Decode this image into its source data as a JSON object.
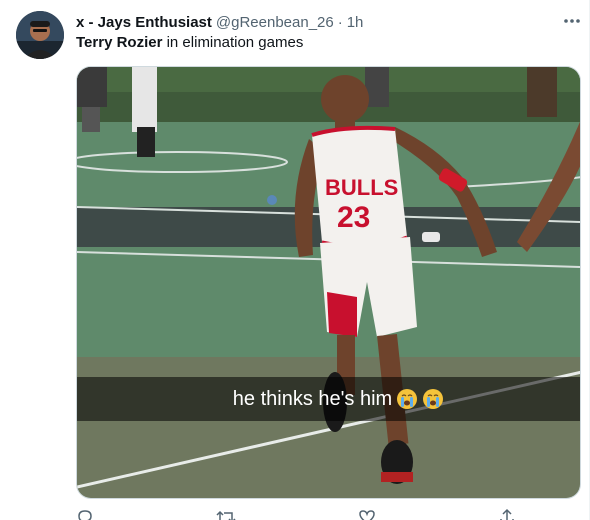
{
  "author": {
    "display_name": "x - Jays Enthusiast",
    "handle": "@gReenbean_26",
    "separator": "·",
    "time": "1h"
  },
  "tweet": {
    "mention": "Terry Rozier",
    "text_rest": " in elimination games"
  },
  "media": {
    "caption": "he thinks he's him",
    "jersey_team": "BULLS",
    "jersey_number": "23",
    "emoji_icon": "loudly-crying-face-icon"
  },
  "actions": {
    "reply_icon": "reply-icon",
    "retweet_icon": "retweet-icon",
    "like_icon": "heart-icon",
    "share_icon": "share-icon"
  },
  "colors": {
    "text_primary": "#0f1419",
    "text_secondary": "#536471",
    "court_green": "#5f8a6b",
    "jersey_red": "#c8102e"
  }
}
